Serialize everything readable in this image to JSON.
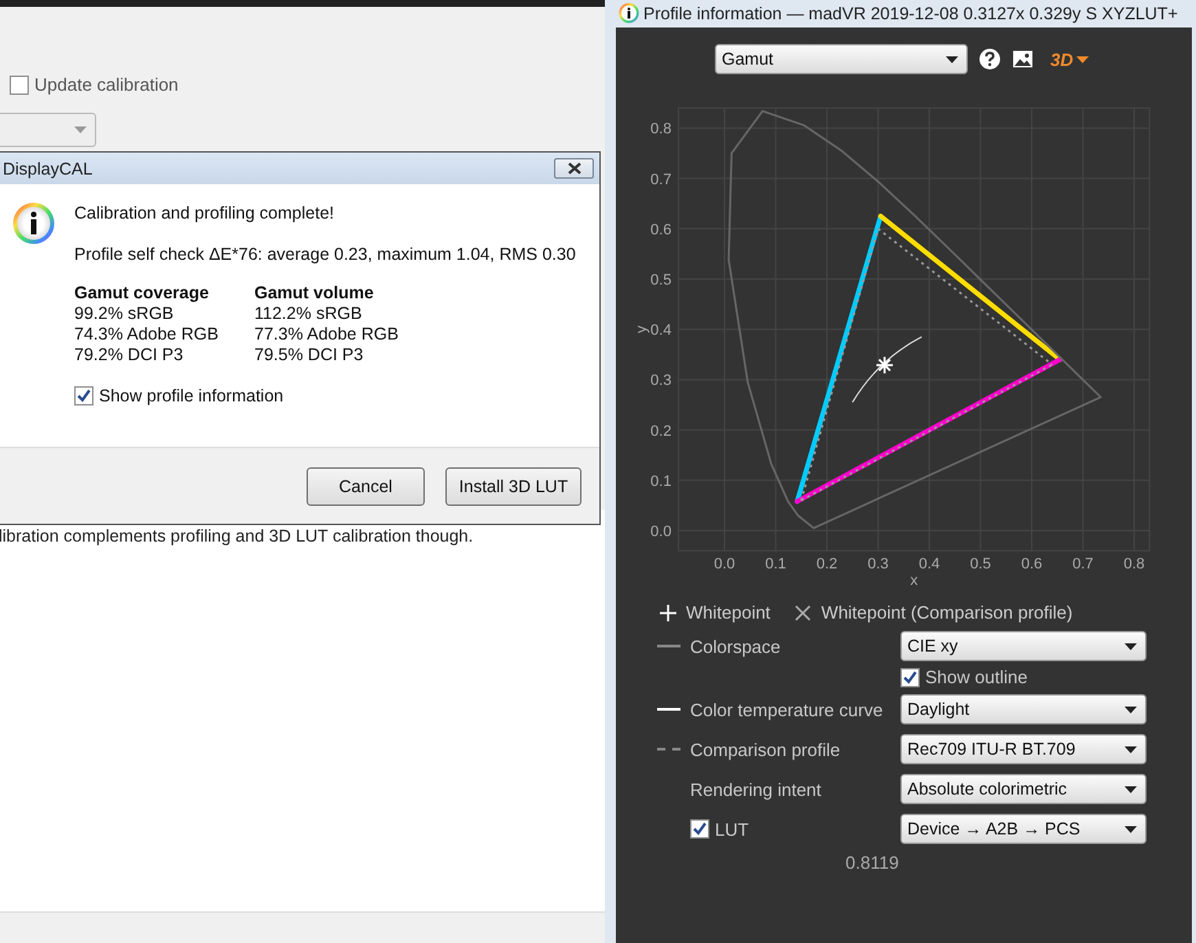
{
  "background_window": {
    "update_checkbox": {
      "label": "Update calibration",
      "checked": false
    },
    "body_text": "libration complements profiling and 3D LUT calibration though."
  },
  "dialog": {
    "title": "DisplayCAL",
    "heading": "Calibration and profiling complete!",
    "self_check": "Profile self check ΔE*76: average 0.23, maximum 1.04, RMS 0.30",
    "columns": [
      {
        "heading": "Gamut coverage",
        "lines": [
          "99.2% sRGB",
          "74.3% Adobe RGB",
          "79.2% DCI P3"
        ]
      },
      {
        "heading": "Gamut volume",
        "lines": [
          "112.2% sRGB",
          "77.3% Adobe RGB",
          "79.5% DCI P3"
        ]
      }
    ],
    "show_info": {
      "label": "Show profile information",
      "checked": true
    },
    "buttons": [
      "Cancel",
      "Install 3D LUT"
    ]
  },
  "profile_window": {
    "title": "Profile information — madVR 2019-12-08 0.3127x 0.329y S XYZLUT+",
    "view_select": {
      "value": "Gamut"
    },
    "view_3d": "3D",
    "chart_data": {
      "type": "line",
      "xlabel": "x",
      "ylabel": "y",
      "xlim": [
        -0.09,
        0.83
      ],
      "ylim": [
        -0.04,
        0.84
      ],
      "xticks": [
        {
          "value": 0,
          "label": "0.0"
        },
        {
          "value": 0.1,
          "label": "0.1"
        },
        {
          "value": 0.2,
          "label": "0.2"
        },
        {
          "value": 0.3,
          "label": "0.3"
        },
        {
          "value": 0.4,
          "label": "0.4"
        },
        {
          "value": 0.5,
          "label": "0.5"
        },
        {
          "value": 0.6,
          "label": "0.6"
        },
        {
          "value": 0.7,
          "label": "0.7"
        },
        {
          "value": 0.8,
          "label": "0.8"
        }
      ],
      "yticks": [
        {
          "value": 0,
          "label": "0.0"
        },
        {
          "value": 0.1,
          "label": "0.1"
        },
        {
          "value": 0.2,
          "label": "0.2"
        },
        {
          "value": 0.3,
          "label": "0.3"
        },
        {
          "value": 0.4,
          "label": "0.4"
        },
        {
          "value": 0.5,
          "label": "0.5"
        },
        {
          "value": 0.6,
          "label": "0.6"
        },
        {
          "value": 0.7,
          "label": "0.7"
        },
        {
          "value": 0.8,
          "label": "0.8"
        }
      ],
      "grid": true,
      "series": [
        {
          "color": "#00ccff",
          "x": [
            0.142,
            0.305
          ],
          "values": [
            0.058,
            0.625
          ]
        },
        {
          "color": "#ffdd00",
          "x": [
            0.305,
            0.655
          ],
          "values": [
            0.625,
            0.34
          ]
        },
        {
          "color": "#ff00cc",
          "x": [
            0.142,
            0.655
          ],
          "values": [
            0.058,
            0.34
          ]
        },
        {
          "color": "#999999",
          "line_style": "dashed",
          "x": [
            0.15,
            0.3
          ],
          "values": [
            0.06,
            0.6
          ]
        },
        {
          "color": "#999999",
          "line_style": "dashed",
          "x": [
            0.3,
            0.64
          ],
          "values": [
            0.6,
            0.33
          ]
        },
        {
          "color": "#999999",
          "line_style": "dashed",
          "x": [
            0.15,
            0.64
          ],
          "values": [
            0.06,
            0.33
          ]
        }
      ]
    },
    "legend": [
      {
        "kind": "plus",
        "label": "Whitepoint"
      },
      {
        "kind": "cross",
        "label": "Whitepoint (Comparison profile)"
      }
    ],
    "options": [
      {
        "kind": "gray-line-select",
        "label": "Colorspace",
        "value": "CIE xy"
      },
      {
        "kind": "checkbox",
        "label": "Show outline",
        "checked": true
      },
      {
        "kind": "white-line-select",
        "label": "Color temperature curve",
        "value": "Daylight"
      },
      {
        "kind": "dashed-line-select",
        "label": "Comparison profile",
        "value": "Rec709 ITU-R BT.709"
      },
      {
        "kind": "select",
        "label": "Rendering intent",
        "value": "Absolute colorimetric"
      },
      {
        "kind": "checkbox-select",
        "label": "LUT",
        "checked": true,
        "value": "Device → A2B → PCS"
      }
    ],
    "cursor_readout": "0.8119"
  }
}
